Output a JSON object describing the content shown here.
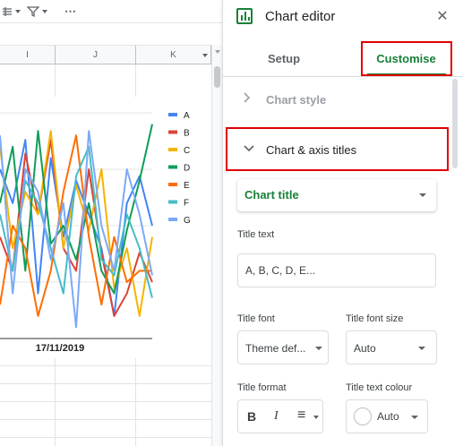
{
  "toolbar": {
    "icons": [
      "table-options-icon",
      "filter-options-icon",
      "more-options-icon"
    ],
    "more_label": "⋯"
  },
  "sheet": {
    "columns": [
      "I",
      "J",
      "K"
    ]
  },
  "chart_data": {
    "type": "line",
    "title": "",
    "x": [
      "17/11/2019"
    ],
    "xtick_label": "17/11/2019",
    "grid": true,
    "legend_position": "right",
    "series": [
      {
        "name": "A",
        "color": "#4285f4",
        "values": [
          75,
          60,
          88,
          20,
          80,
          45,
          70,
          55,
          40,
          10,
          60,
          72,
          50
        ]
      },
      {
        "name": "B",
        "color": "#db4437",
        "values": [
          45,
          30,
          82,
          55,
          88,
          40,
          30,
          75,
          38,
          10,
          20,
          38,
          25
        ]
      },
      {
        "name": "C",
        "color": "#f4b400",
        "values": [
          85,
          40,
          65,
          55,
          92,
          40,
          68,
          48,
          75,
          22,
          40,
          10,
          45
        ]
      },
      {
        "name": "D",
        "color": "#0f9d58",
        "values": [
          60,
          85,
          30,
          92,
          42,
          50,
          35,
          60,
          30,
          20,
          48,
          70,
          95
        ]
      },
      {
        "name": "E",
        "color": "#ff6d01",
        "values": [
          15,
          50,
          40,
          10,
          30,
          65,
          90,
          45,
          15,
          45,
          25,
          30,
          30
        ]
      },
      {
        "name": "F",
        "color": "#46bdc6",
        "values": [
          55,
          30,
          70,
          60,
          40,
          20,
          72,
          85,
          35,
          28,
          55,
          40,
          18
        ]
      },
      {
        "name": "G",
        "color": "#7baaf7",
        "values": [
          90,
          20,
          75,
          65,
          35,
          60,
          5,
          92,
          50,
          30,
          75,
          55,
          28
        ]
      }
    ]
  },
  "editor": {
    "title": "Chart editor",
    "close_icon": "✕",
    "tabs": [
      "Setup",
      "Customise"
    ],
    "active_tab": "Customise",
    "sections": {
      "chart_style": "Chart style",
      "chart_axis_titles": "Chart & axis titles"
    },
    "title_type_select": "Chart title",
    "title_text_label": "Title text",
    "title_text_value": "A, B, C, D, E...",
    "title_font_label": "Title font",
    "title_font_value": "Theme def...",
    "title_font_size_label": "Title font size",
    "title_font_size_value": "Auto",
    "title_format_label": "Title format",
    "title_text_colour_label": "Title text colour",
    "title_text_colour_value": "Auto",
    "format_buttons": {
      "bold": "B",
      "italic": "I",
      "align": "≡"
    }
  },
  "colors": {
    "accent": "#188038",
    "highlight": "#e00000"
  }
}
